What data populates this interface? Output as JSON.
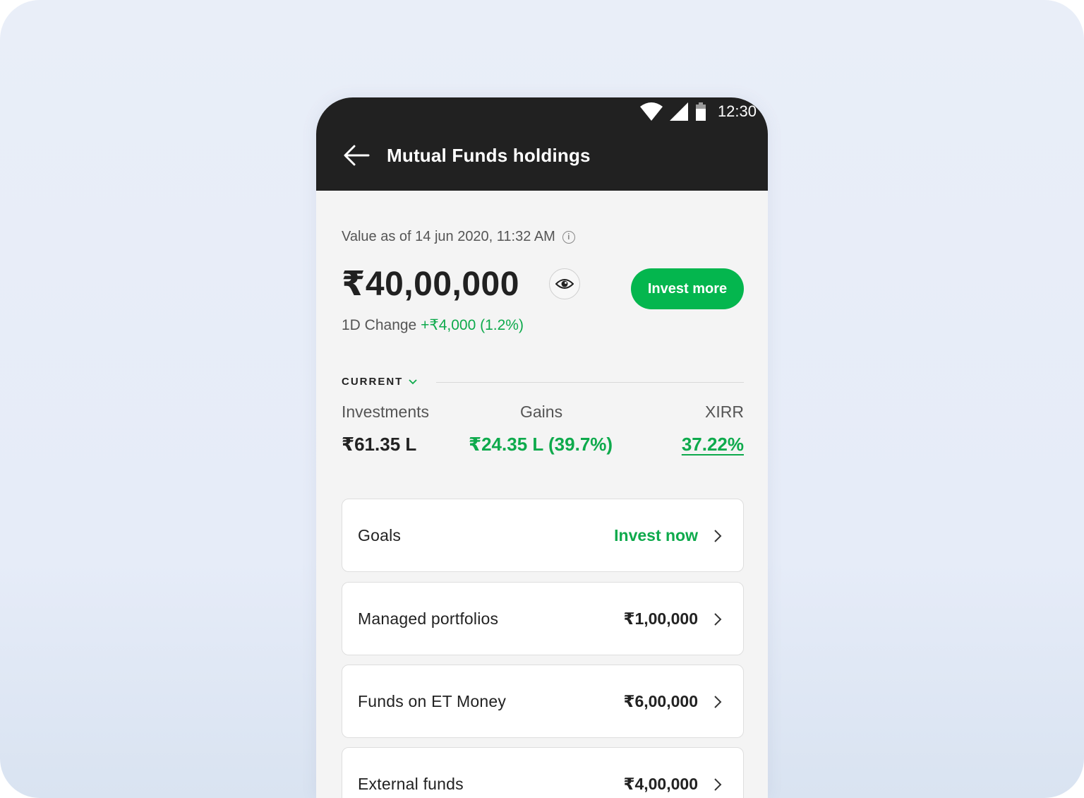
{
  "status_bar": {
    "time": "12:30"
  },
  "header": {
    "title": "Mutual Funds holdings"
  },
  "summary": {
    "as_of": "Value as of 14 jun 2020, 11:32 AM",
    "total_value": "₹40,00,000",
    "invest_more_label": "Invest more",
    "change_label": "1D Change",
    "change_value": "+₹4,000 (1.2%)"
  },
  "current": {
    "label": "CURRENT",
    "investments_label": "Investments",
    "investments_value": "₹61.35 L",
    "gains_label": "Gains",
    "gains_value": "₹24.35 L (39.7%)",
    "xirr_label": "XIRR",
    "xirr_value": "37.22%"
  },
  "cards": [
    {
      "label": "Goals",
      "value": "Invest now"
    },
    {
      "label": "Managed portfolios",
      "value": "₹1,00,000"
    },
    {
      "label": "Funds on ET Money",
      "value": "₹6,00,000"
    },
    {
      "label": "External funds",
      "value": "₹4,00,000"
    }
  ],
  "colors": {
    "accent_green": "#04b64e",
    "header_bg": "#212121"
  }
}
